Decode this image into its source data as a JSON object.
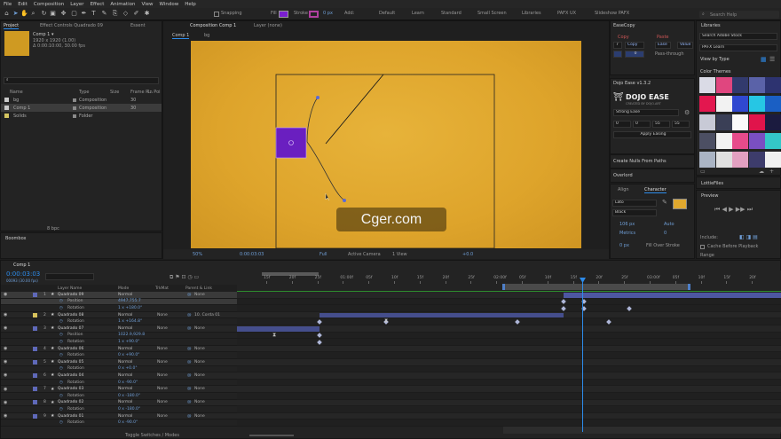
{
  "menu": [
    "File",
    "Edit",
    "Composition",
    "Layer",
    "Effect",
    "Animation",
    "View",
    "Window",
    "Help"
  ],
  "toolbar": {
    "snapping": "Snapping",
    "fill": "Fill",
    "stroke": "Stroke",
    "stroke_px": "0 px",
    "add": "Add:",
    "workspaces": [
      "Default",
      "Learn",
      "Standard",
      "Small Screen",
      "Libraries",
      "PAFX UX",
      "Slideshow PAFX"
    ],
    "search": "Search Help"
  },
  "project": {
    "tab_project": "Project",
    "tab_effect": "Effect Controls Quadrado 09",
    "tab_extra": "Essent",
    "comp_name": "Comp 1 ▾",
    "comp_size": "1920 x 1920 (1.00)",
    "comp_duration": "Δ 0:00:10:00, 30.00 fps",
    "search_ph": "",
    "headers": {
      "name": "Name",
      "type": "Type",
      "size": "Size",
      "rate": "Frame R...",
      "sched": "In Poi"
    },
    "items": [
      {
        "name": "bg",
        "type": "Composition",
        "rate": "30",
        "color": "#c9c9c9"
      },
      {
        "name": "Comp 1",
        "type": "Composition",
        "rate": "30",
        "color": "#c9c9c9"
      },
      {
        "name": "Solids",
        "type": "Folder",
        "rate": "",
        "color": "#d4c560"
      }
    ],
    "footer": "8 bpc"
  },
  "bottom_left_tab": "Boombox",
  "viewer": {
    "tab": "Composition Comp 1",
    "tab_extra": "Layer (none)",
    "sub_tab1": "Comp 1",
    "sub_tab2": "bg",
    "zoom": "50%",
    "timecode": "0:00:03:03",
    "resolution": "Full",
    "camera": "Active Camera",
    "views": "1 View",
    "exposure": "+0.0"
  },
  "watermark": "Cger.com",
  "easecopy": {
    "title": "EaseCopy",
    "copy_label": "Copy",
    "paste_label": "Paste",
    "copy_btn": "Copy",
    "ease_btn": "Ease",
    "value_btn": "Value",
    "num1": "7",
    "num2": "0",
    "pass_through": "Pass-through"
  },
  "dojo": {
    "title": "Dojo Ease v1.3.2",
    "logo": "DOJO EASE",
    "subtitle": "CREATED BY DOJO.ART",
    "preset": "Strong Ease",
    "vals": [
      "0",
      "0",
      "55",
      "55"
    ],
    "apply": "Apply Easing"
  },
  "nulls": {
    "title": "Create Nulls From Paths"
  },
  "overlord": {
    "title": "Overlord"
  },
  "character": {
    "tab_align": "Align",
    "tab_char": "Character",
    "font": "Lato",
    "style": "Black",
    "size": "106 px",
    "leading": "Auto",
    "tracking": "0",
    "kern": "Metrics",
    "stroke": "0 px",
    "stroke_mode": "Fill Over Stroke"
  },
  "libraries": {
    "title": "Libraries",
    "search_ph": "Search Adobe Stock",
    "lib": "PAFX Learn",
    "view_by": "View by Type",
    "group": "Color Themes",
    "lottie": "LottieFiles"
  },
  "themes": [
    [
      "#dadbe6",
      "#e0467f",
      "#323a6d",
      "#5a62a8",
      "#2d3370"
    ],
    [
      "#e3174f",
      "#f2f2f2",
      "#3048d0",
      "#26c6e4",
      "#1a5fc4"
    ],
    [
      "#c8cad6",
      "#3a3f56",
      "#fafafa",
      "#e0144b",
      "#1b1b3f"
    ],
    [
      "#4c4f63",
      "#f2f2f2",
      "#e64b8b",
      "#7a4fc2",
      "#34c7c7"
    ],
    [
      "#aab4c4",
      "#e0e0e0",
      "#e3a0c1",
      "#3d3c6b",
      "#f0f0f0"
    ]
  ],
  "preview": {
    "title": "Preview",
    "include": "Include:",
    "cache": "Cache Before Playback",
    "range": "Range"
  },
  "timeline": {
    "tab": "Comp 1",
    "timecode": "0:00:03:03",
    "timecode_sub": "00093 (30.00 fps)",
    "headers": {
      "layer": "Layer Name",
      "mode": "Mode",
      "trkmat": "TrkMat",
      "parent": "Parent & Link"
    },
    "ruler": [
      "15f",
      "20f",
      "25f",
      "01:00f",
      "05f",
      "10f",
      "15f",
      "20f",
      "25f",
      "02:00f",
      "05f",
      "10f",
      "15f",
      "20f",
      "25f",
      "03:00f",
      "05f",
      "10f",
      "15f",
      "20f",
      "04:00f"
    ],
    "footer": "Toggle Switches / Modes",
    "rows": [
      {
        "num": "1",
        "name": "Quadrado 09",
        "mode": "Normal",
        "trk": "",
        "parent": "None",
        "kind": "layer",
        "sel": true
      },
      {
        "num": "",
        "name": "Position",
        "mode": "4947,755.7",
        "trk": "",
        "parent": "",
        "kind": "prop",
        "sel": true
      },
      {
        "num": "",
        "name": "Rotation",
        "mode": "1 x +180.0°",
        "trk": "",
        "parent": "",
        "kind": "prop",
        "sel": false
      },
      {
        "num": "2",
        "name": "Quadrado 08",
        "mode": "Normal",
        "trk": "None",
        "parent": "10. Corda 01",
        "kind": "layer",
        "sel": false
      },
      {
        "num": "",
        "name": "Rotation",
        "mode": "1 x +164.8°",
        "trk": "",
        "parent": "",
        "kind": "prop",
        "sel": false
      },
      {
        "num": "3",
        "name": "Quadrado 07",
        "mode": "Normal",
        "trk": "None",
        "parent": "None",
        "kind": "layer",
        "sel": false
      },
      {
        "num": "",
        "name": "Position",
        "mode": "1022.9,929.8",
        "trk": "",
        "parent": "",
        "kind": "prop",
        "sel": false
      },
      {
        "num": "",
        "name": "Rotation",
        "mode": "1 x +90.0°",
        "trk": "",
        "parent": "",
        "kind": "prop",
        "sel": false
      },
      {
        "num": "4",
        "name": "Quadrado 06",
        "mode": "Normal",
        "trk": "None",
        "parent": "None",
        "kind": "layer",
        "sel": false
      },
      {
        "num": "",
        "name": "Rotation",
        "mode": "0 x +90.0°",
        "trk": "",
        "parent": "",
        "kind": "prop",
        "sel": false
      },
      {
        "num": "5",
        "name": "Quadrado 05",
        "mode": "Normal",
        "trk": "None",
        "parent": "None",
        "kind": "layer",
        "sel": false
      },
      {
        "num": "",
        "name": "Rotation",
        "mode": "0 x +0.0°",
        "trk": "",
        "parent": "",
        "kind": "prop",
        "sel": false
      },
      {
        "num": "6",
        "name": "Quadrado 04",
        "mode": "Normal",
        "trk": "None",
        "parent": "None",
        "kind": "layer",
        "sel": false
      },
      {
        "num": "",
        "name": "Rotation",
        "mode": "0 x -90.0°",
        "trk": "",
        "parent": "",
        "kind": "prop",
        "sel": false
      },
      {
        "num": "7",
        "name": "Quadrado 03",
        "mode": "Normal",
        "trk": "None",
        "parent": "None",
        "kind": "layer",
        "sel": false
      },
      {
        "num": "",
        "name": "Rotation",
        "mode": "0 x -180.0°",
        "trk": "",
        "parent": "",
        "kind": "prop",
        "sel": false
      },
      {
        "num": "8",
        "name": "Quadrado 02",
        "mode": "Normal",
        "trk": "None",
        "parent": "None",
        "kind": "layer",
        "sel": false
      },
      {
        "num": "",
        "name": "Rotation",
        "mode": "0 x -180.0°",
        "trk": "",
        "parent": "",
        "kind": "prop",
        "sel": false
      },
      {
        "num": "9",
        "name": "Quadrado 01",
        "mode": "Normal",
        "trk": "None",
        "parent": "None",
        "kind": "layer",
        "sel": false
      },
      {
        "num": "",
        "name": "Rotation",
        "mode": "0 x -90.0°",
        "trk": "",
        "parent": "",
        "kind": "prop",
        "sel": false
      }
    ]
  },
  "colors": {
    "accent": "#2d8ceb",
    "canvas": "#e0a82e",
    "square": "#6a1fc0",
    "track": "#454e8c"
  }
}
